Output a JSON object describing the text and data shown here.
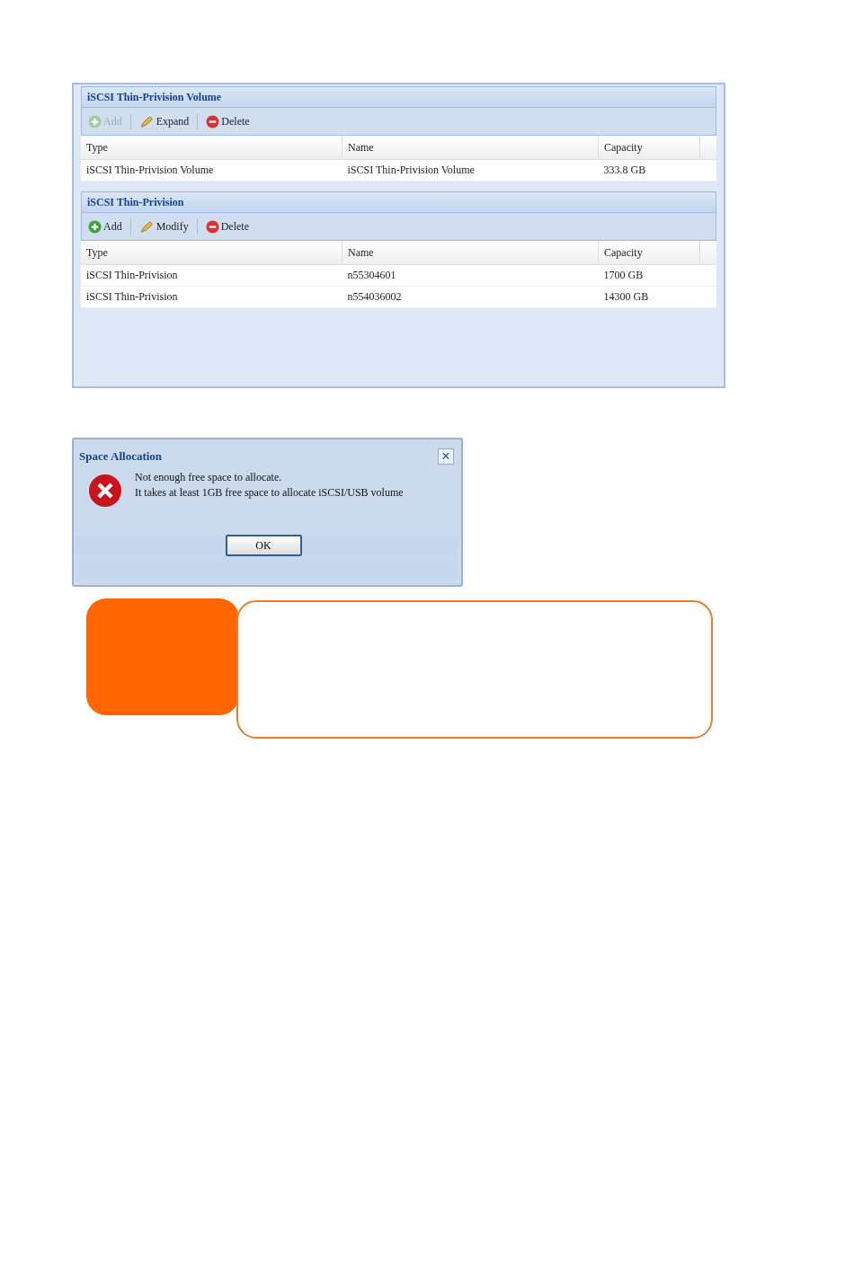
{
  "panels": [
    {
      "title": "iSCSI Thin-Privision Volume",
      "toolbar": [
        {
          "kind": "add",
          "label": "Add",
          "disabled": true
        },
        {
          "kind": "edit",
          "label": "Expand",
          "disabled": false
        },
        {
          "kind": "delete",
          "label": "Delete",
          "disabled": false
        }
      ],
      "columns": [
        "Type",
        "Name",
        "Capacity"
      ],
      "rows": [
        [
          "iSCSI Thin-Privision Volume",
          "iSCSI Thin-Privision Volume",
          "333.8 GB"
        ]
      ]
    },
    {
      "title": "iSCSI Thin-Privision",
      "toolbar": [
        {
          "kind": "add",
          "label": "Add",
          "disabled": false
        },
        {
          "kind": "edit",
          "label": "Modify",
          "disabled": false
        },
        {
          "kind": "delete",
          "label": "Delete",
          "disabled": false
        }
      ],
      "columns": [
        "Type",
        "Name",
        "Capacity"
      ],
      "rows": [
        [
          "iSCSI Thin-Privision",
          "n55304601",
          "1700 GB"
        ],
        [
          "iSCSI Thin-Privision",
          "n554036002",
          "14300 GB"
        ]
      ]
    }
  ],
  "dialog": {
    "title": "Space Allocation",
    "close": "×",
    "message": [
      "Not enough free space to allocate.",
      "It takes at least 1GB free space to allocate iSCSI/USB volume"
    ],
    "button": "OK"
  }
}
